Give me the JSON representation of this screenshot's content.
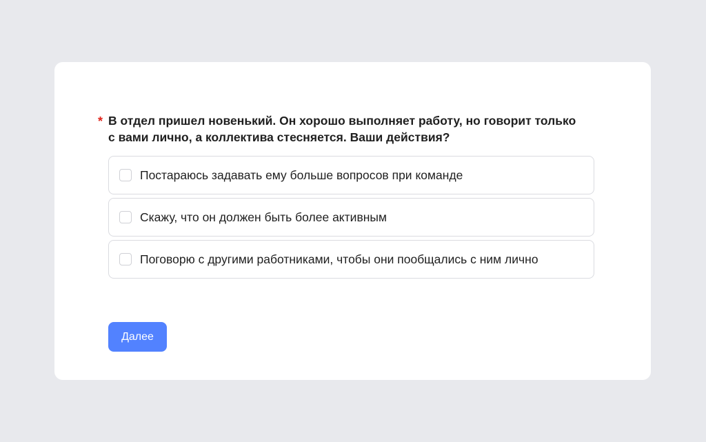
{
  "question": {
    "required_marker": "*",
    "text": "В отдел пришел новенький. Он хорошо выполняет работу, но говорит только с вами лично, а коллектива стесняется. Ваши действия?"
  },
  "options": [
    {
      "label": "Постараюсь задавать ему больше вопросов при команде",
      "checked": false
    },
    {
      "label": "Скажу, что он должен быть более активным",
      "checked": false
    },
    {
      "label": "Поговорю с другими работниками, чтобы они пообщались с ним лично",
      "checked": false
    }
  ],
  "actions": {
    "next_label": "Далее"
  },
  "colors": {
    "background": "#e8e9ed",
    "card": "#ffffff",
    "accent": "#5282ff",
    "required": "#e0241b"
  }
}
